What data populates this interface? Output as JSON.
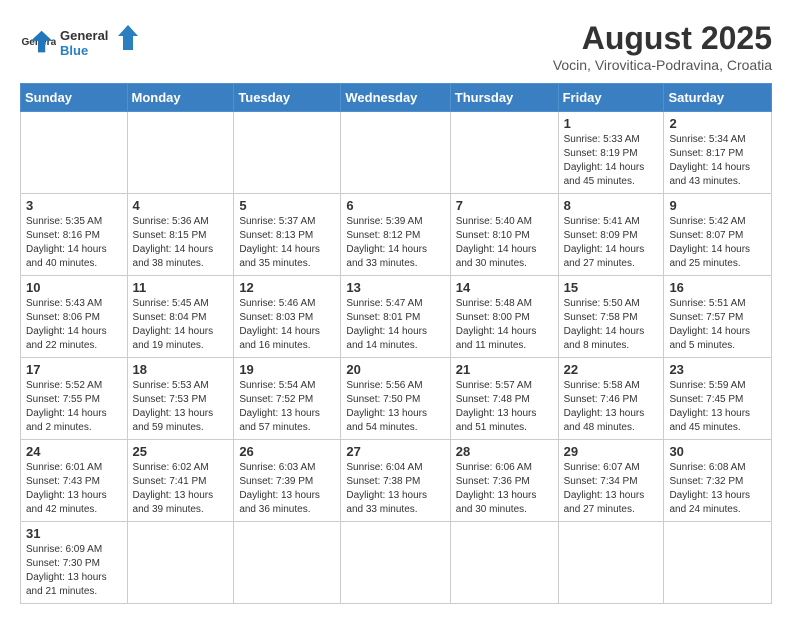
{
  "header": {
    "logo_general": "General",
    "logo_blue": "Blue",
    "month_year": "August 2025",
    "subtitle": "Vocin, Virovitica-Podravina, Croatia"
  },
  "days_of_week": [
    "Sunday",
    "Monday",
    "Tuesday",
    "Wednesday",
    "Thursday",
    "Friday",
    "Saturday"
  ],
  "weeks": [
    [
      {
        "day": "",
        "info": ""
      },
      {
        "day": "",
        "info": ""
      },
      {
        "day": "",
        "info": ""
      },
      {
        "day": "",
        "info": ""
      },
      {
        "day": "",
        "info": ""
      },
      {
        "day": "1",
        "info": "Sunrise: 5:33 AM\nSunset: 8:19 PM\nDaylight: 14 hours and 45 minutes."
      },
      {
        "day": "2",
        "info": "Sunrise: 5:34 AM\nSunset: 8:17 PM\nDaylight: 14 hours and 43 minutes."
      }
    ],
    [
      {
        "day": "3",
        "info": "Sunrise: 5:35 AM\nSunset: 8:16 PM\nDaylight: 14 hours and 40 minutes."
      },
      {
        "day": "4",
        "info": "Sunrise: 5:36 AM\nSunset: 8:15 PM\nDaylight: 14 hours and 38 minutes."
      },
      {
        "day": "5",
        "info": "Sunrise: 5:37 AM\nSunset: 8:13 PM\nDaylight: 14 hours and 35 minutes."
      },
      {
        "day": "6",
        "info": "Sunrise: 5:39 AM\nSunset: 8:12 PM\nDaylight: 14 hours and 33 minutes."
      },
      {
        "day": "7",
        "info": "Sunrise: 5:40 AM\nSunset: 8:10 PM\nDaylight: 14 hours and 30 minutes."
      },
      {
        "day": "8",
        "info": "Sunrise: 5:41 AM\nSunset: 8:09 PM\nDaylight: 14 hours and 27 minutes."
      },
      {
        "day": "9",
        "info": "Sunrise: 5:42 AM\nSunset: 8:07 PM\nDaylight: 14 hours and 25 minutes."
      }
    ],
    [
      {
        "day": "10",
        "info": "Sunrise: 5:43 AM\nSunset: 8:06 PM\nDaylight: 14 hours and 22 minutes."
      },
      {
        "day": "11",
        "info": "Sunrise: 5:45 AM\nSunset: 8:04 PM\nDaylight: 14 hours and 19 minutes."
      },
      {
        "day": "12",
        "info": "Sunrise: 5:46 AM\nSunset: 8:03 PM\nDaylight: 14 hours and 16 minutes."
      },
      {
        "day": "13",
        "info": "Sunrise: 5:47 AM\nSunset: 8:01 PM\nDaylight: 14 hours and 14 minutes."
      },
      {
        "day": "14",
        "info": "Sunrise: 5:48 AM\nSunset: 8:00 PM\nDaylight: 14 hours and 11 minutes."
      },
      {
        "day": "15",
        "info": "Sunrise: 5:50 AM\nSunset: 7:58 PM\nDaylight: 14 hours and 8 minutes."
      },
      {
        "day": "16",
        "info": "Sunrise: 5:51 AM\nSunset: 7:57 PM\nDaylight: 14 hours and 5 minutes."
      }
    ],
    [
      {
        "day": "17",
        "info": "Sunrise: 5:52 AM\nSunset: 7:55 PM\nDaylight: 14 hours and 2 minutes."
      },
      {
        "day": "18",
        "info": "Sunrise: 5:53 AM\nSunset: 7:53 PM\nDaylight: 13 hours and 59 minutes."
      },
      {
        "day": "19",
        "info": "Sunrise: 5:54 AM\nSunset: 7:52 PM\nDaylight: 13 hours and 57 minutes."
      },
      {
        "day": "20",
        "info": "Sunrise: 5:56 AM\nSunset: 7:50 PM\nDaylight: 13 hours and 54 minutes."
      },
      {
        "day": "21",
        "info": "Sunrise: 5:57 AM\nSunset: 7:48 PM\nDaylight: 13 hours and 51 minutes."
      },
      {
        "day": "22",
        "info": "Sunrise: 5:58 AM\nSunset: 7:46 PM\nDaylight: 13 hours and 48 minutes."
      },
      {
        "day": "23",
        "info": "Sunrise: 5:59 AM\nSunset: 7:45 PM\nDaylight: 13 hours and 45 minutes."
      }
    ],
    [
      {
        "day": "24",
        "info": "Sunrise: 6:01 AM\nSunset: 7:43 PM\nDaylight: 13 hours and 42 minutes."
      },
      {
        "day": "25",
        "info": "Sunrise: 6:02 AM\nSunset: 7:41 PM\nDaylight: 13 hours and 39 minutes."
      },
      {
        "day": "26",
        "info": "Sunrise: 6:03 AM\nSunset: 7:39 PM\nDaylight: 13 hours and 36 minutes."
      },
      {
        "day": "27",
        "info": "Sunrise: 6:04 AM\nSunset: 7:38 PM\nDaylight: 13 hours and 33 minutes."
      },
      {
        "day": "28",
        "info": "Sunrise: 6:06 AM\nSunset: 7:36 PM\nDaylight: 13 hours and 30 minutes."
      },
      {
        "day": "29",
        "info": "Sunrise: 6:07 AM\nSunset: 7:34 PM\nDaylight: 13 hours and 27 minutes."
      },
      {
        "day": "30",
        "info": "Sunrise: 6:08 AM\nSunset: 7:32 PM\nDaylight: 13 hours and 24 minutes."
      }
    ],
    [
      {
        "day": "31",
        "info": "Sunrise: 6:09 AM\nSunset: 7:30 PM\nDaylight: 13 hours and 21 minutes."
      },
      {
        "day": "",
        "info": ""
      },
      {
        "day": "",
        "info": ""
      },
      {
        "day": "",
        "info": ""
      },
      {
        "day": "",
        "info": ""
      },
      {
        "day": "",
        "info": ""
      },
      {
        "day": "",
        "info": ""
      }
    ]
  ]
}
